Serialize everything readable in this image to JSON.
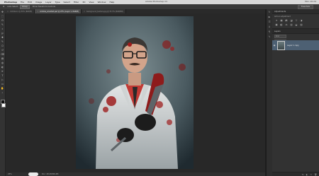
{
  "menu": {
    "apple": "",
    "app": "Photoshop",
    "items": [
      "File",
      "Edit",
      "Image",
      "Layer",
      "Type",
      "Select",
      "Filter",
      "3D",
      "View",
      "Window",
      "Help"
    ],
    "window_title": "Adobe Photoshop CC",
    "right": "Mon 10:24"
  },
  "options": {
    "auto_select_label": "Auto-Select:",
    "auto_select_value": "Group",
    "transform_label": "Show Transform Controls",
    "workspace": "Essentials"
  },
  "tabs": [
    {
      "label": "Untitled-1 @ 50% (RGB/8)",
      "active": false
    },
    {
      "label": "zombie_scientist.psd @ 25% (Layer 1, RGB/8)",
      "active": true
    },
    {
      "label": "background_texture.jpg @ 33.3% (RGB/8#)",
      "active": false
    }
  ],
  "tools": [
    "move-icon",
    "marquee-icon",
    "lasso-icon",
    "quick-select-icon",
    "crop-icon",
    "eyedropper-icon",
    "healing-icon",
    "brush-icon",
    "clone-stamp-icon",
    "history-brush-icon",
    "eraser-icon",
    "gradient-icon",
    "blur-icon",
    "dodge-icon",
    "pen-icon",
    "type-icon",
    "path-select-icon",
    "shape-icon",
    "hand-icon",
    "zoom-icon"
  ],
  "tool_glyphs": [
    "✥",
    "⬚",
    "ʘ",
    "✎",
    "⌗",
    "ꝑ",
    "✚",
    "✎",
    "⎔",
    "↺",
    "⌫",
    "▤",
    "◍",
    "◐",
    "✒",
    "T",
    "▷",
    "▭",
    "✋",
    "⌕"
  ],
  "colors": {
    "foreground": "#111111",
    "background": "#ffffff",
    "accent": "#4d6073"
  },
  "status": {
    "zoom": "25%",
    "doc": "Doc: 48.2M/96.4M"
  },
  "adjustments": {
    "title": "Adjustments",
    "subtitle": "Add an adjustment",
    "icons": [
      "☀",
      "▦",
      "◩",
      "◪",
      "▽",
      "◑",
      "▣",
      "◧",
      "⚖",
      "▥",
      "◒",
      "▨"
    ]
  },
  "layers": {
    "title": "Layers",
    "kind_label": "Kind",
    "blend_mode": "Normal",
    "opacity_label": "Opacity: 100%",
    "lock_label": "Lock:",
    "fill_label": "Fill: 100%",
    "layer_name": "Layer 1 copy",
    "footer_icons": [
      "fx",
      "◐",
      "▭",
      "🗑"
    ]
  },
  "icon_strip": [
    "history-icon",
    "actions-icon",
    "properties-icon",
    "character-icon",
    "paragraph-icon",
    "brushes-icon"
  ],
  "icon_strip_glyphs": [
    "↻",
    "▶",
    "☰",
    "A",
    "¶",
    "✎"
  ]
}
